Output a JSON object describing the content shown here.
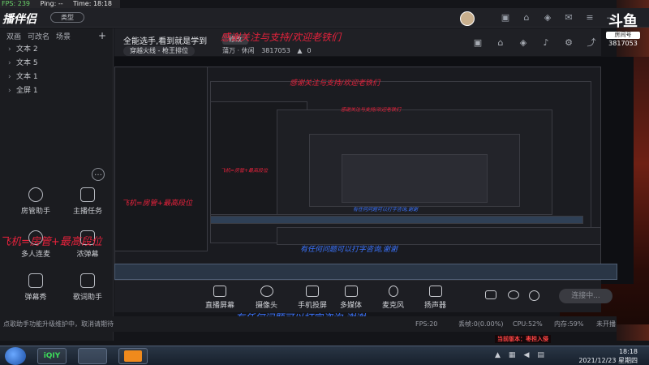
{
  "stats": {
    "fps_label": "FPS: 239",
    "ping_label": "Ping: --",
    "time_label": "Time: 18:18"
  },
  "header": {
    "logo": "播伴侣",
    "mode_button": "类型"
  },
  "douyu": {
    "brand": "斗鱼",
    "room_label": "房间号",
    "room_number": "3817053"
  },
  "sidebar": {
    "tabs": [
      "双画",
      "可改名",
      "场景"
    ],
    "add": "+",
    "scenes": [
      "文本 2",
      "文本 5",
      "文本 1",
      "全屏 1"
    ],
    "more": "…",
    "tools": [
      {
        "label": "房管助手",
        "icon": "user-icon"
      },
      {
        "label": "主播任务",
        "icon": "task-icon"
      },
      {
        "label": "多人连麦",
        "icon": "multi-user-icon"
      },
      {
        "label": "浓弹幕",
        "icon": "danmu-icon"
      },
      {
        "label": "弹幕秀",
        "icon": "tv-icon"
      },
      {
        "label": "歌词助手",
        "icon": "lyric-icon"
      },
      {
        "label": "",
        "icon": "game-icon"
      },
      {
        "label": "",
        "icon": "car-icon"
      }
    ]
  },
  "main": {
    "title": "全能选手,看到就是学到",
    "edit": "修改",
    "category": "穿越火线 - 枪王排位",
    "meta_channel": "蒲万 · 休闲",
    "room_id": "3817053",
    "viewers": "0"
  },
  "overlays": {
    "red_banner": "感谢关注与支持/欢迎老铁们",
    "red_sub": "飞机=房管+最高段位",
    "blue_banner": "有任何问题可以打字咨询,谢谢"
  },
  "toolbar": {
    "items": [
      "直播屏幕",
      "摄像头",
      "手机投屏",
      "多媒体",
      "麦克风",
      "扬声器"
    ],
    "live_button": "连接中..."
  },
  "statusbar": {
    "notice": "点歌助手功能升级维护中，取消请期待",
    "fps": "FPS:20",
    "drop": "丢帧:0(0.00%)",
    "cpu": "CPU:52%",
    "mem": "内存:59%",
    "status": "未开播"
  },
  "version_text": "当前版本：枣担入侵",
  "taskbar": {
    "app1": "iQIY",
    "time": "18:18",
    "date": "2021/12/23 星期四"
  }
}
